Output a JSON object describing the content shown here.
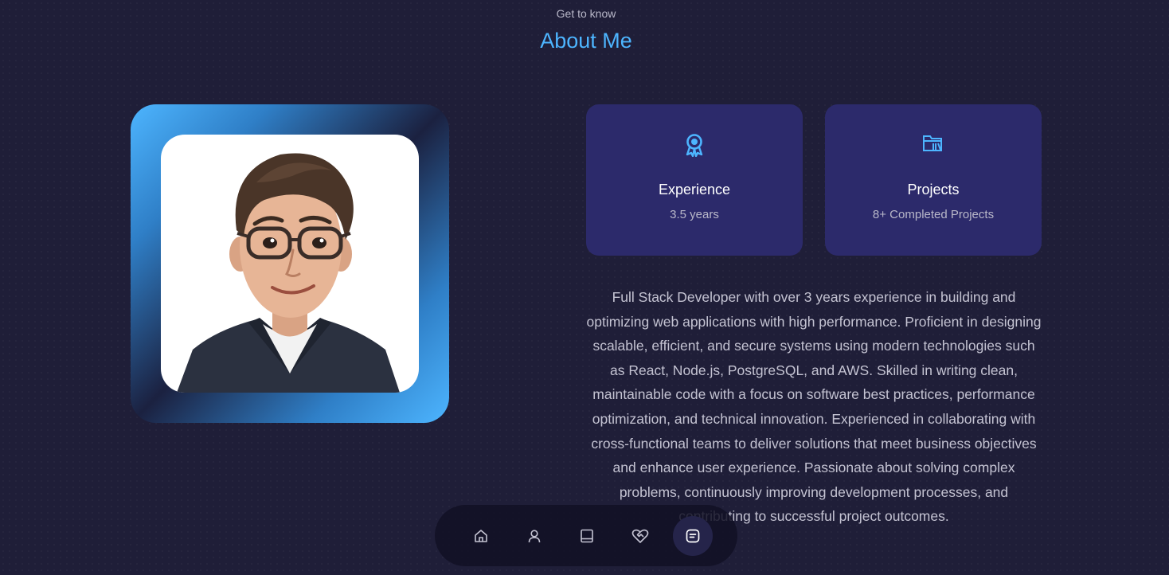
{
  "header": {
    "subtitle": "Get to know",
    "title": "About Me"
  },
  "cards": [
    {
      "icon": "award-icon",
      "title": "Experience",
      "value": "3.5 years"
    },
    {
      "icon": "projects-folder-icon",
      "title": "Projects",
      "value": "8+ Completed Projects"
    }
  ],
  "about": {
    "text": "Full Stack Developer with over 3 years experience in building and optimizing web applications with high performance. Proficient in designing scalable, efficient, and secure systems using modern technologies such as React, Node.js, PostgreSQL, and AWS. Skilled in writing clean, maintainable code with a focus on software best practices, performance optimization, and technical innovation. Experienced in collaborating with cross-functional teams to deliver solutions that meet business objectives and enhance user experience. Passionate about solving complex problems, continuously improving development processes, and contributing to successful project outcomes."
  },
  "nav": {
    "items": [
      {
        "icon": "home-icon",
        "active": false
      },
      {
        "icon": "user-icon",
        "active": false
      },
      {
        "icon": "book-icon",
        "active": false
      },
      {
        "icon": "heart-handshake-icon",
        "active": false
      },
      {
        "icon": "message-icon",
        "active": true
      }
    ]
  },
  "colors": {
    "accent": "#4db5ff",
    "background": "#1f1e38",
    "card": "#2c2a6b"
  }
}
